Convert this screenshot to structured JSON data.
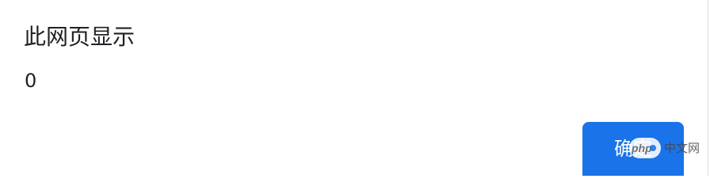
{
  "dialog": {
    "title": "此网页显示",
    "message": "0",
    "ok_label": "确定"
  },
  "watermark": {
    "logo_text": "php",
    "site_text": "中文网"
  },
  "colors": {
    "accent": "#1a73e8",
    "text": "#202124",
    "background": "#ffffff"
  }
}
